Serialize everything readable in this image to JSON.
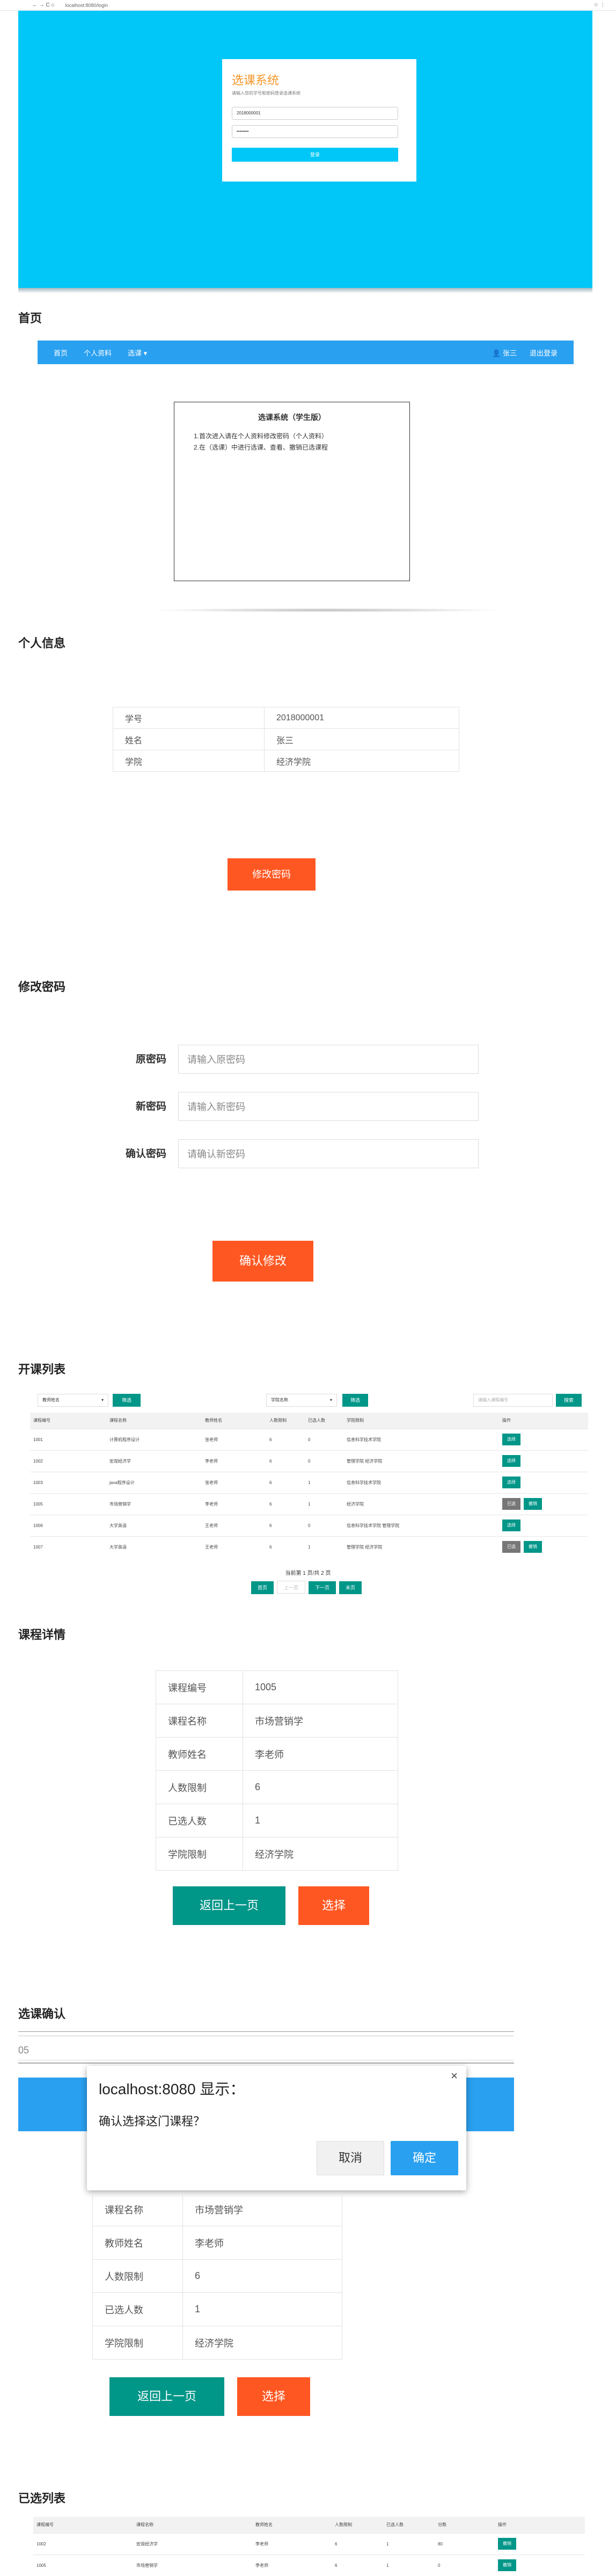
{
  "browser": {
    "url": "localhost:8080/login",
    "nav": "← → C ⌂",
    "right_icons": "☆ ⋮"
  },
  "login": {
    "title": "选课系统",
    "subtitle": "请输入您的学号和密码登录选课系统",
    "username_value": "2018000001",
    "password_value": "••••••••",
    "button": "登录"
  },
  "sections": {
    "home": "首页",
    "profile": "个人信息",
    "change_password": "修改密码",
    "course_list": "开课列表",
    "course_detail": "课程详情",
    "course_confirm": "选课确认",
    "selected_list": "已选列表"
  },
  "nav": {
    "items": [
      "首页",
      "个人资料",
      "选课 ▾"
    ],
    "user": "张三",
    "logout": "退出登录"
  },
  "home": {
    "title": "选课系统（学生版）",
    "lines": [
      "1.首次进入请在个人资料修改密码（个人资料）",
      "2.在（选课）中进行选课、查看、撤销已选课程"
    ]
  },
  "profile": {
    "rows": [
      {
        "label": "学号",
        "value": "2018000001"
      },
      {
        "label": "姓名",
        "value": "张三"
      },
      {
        "label": "学院",
        "value": "经济学院"
      }
    ],
    "button": "修改密码"
  },
  "password": {
    "old_label": "原密码",
    "old_placeholder": "请输入原密码",
    "new_label": "新密码",
    "new_placeholder": "请输入新密码",
    "confirm_label": "确认密码",
    "confirm_placeholder": "请确认新密码",
    "button": "确认修改"
  },
  "course_list": {
    "filter1": "教师姓名",
    "filter1_btn": "筛选",
    "filter2": "学院名称",
    "filter2_btn": "筛选",
    "search_placeholder": "请输入课程编号",
    "search_btn": "搜索",
    "headers": [
      "课程编号",
      "课程名称",
      "教师姓名",
      "人数限制",
      "已选人数",
      "学院限制",
      "操作"
    ],
    "rows": [
      {
        "id": "1001",
        "name": "计算机程序设计",
        "teacher": "张老师",
        "limit": "6",
        "chosen": "0",
        "college": "信息科学技术学院",
        "btns": [
          "选择"
        ]
      },
      {
        "id": "1002",
        "name": "宏观经济学",
        "teacher": "李老师",
        "limit": "6",
        "chosen": "0",
        "college": "管理学院  经济学院",
        "btns": [
          "选择"
        ]
      },
      {
        "id": "1003",
        "name": "java程序设计",
        "teacher": "张老师",
        "limit": "6",
        "chosen": "1",
        "college": "信息科学技术学院",
        "btns": [
          "选择"
        ]
      },
      {
        "id": "1005",
        "name": "市场营销学",
        "teacher": "李老师",
        "limit": "6",
        "chosen": "1",
        "college": "经济学院",
        "btns": [
          "已选",
          "撤销"
        ]
      },
      {
        "id": "1006",
        "name": "大学英语",
        "teacher": "王老师",
        "limit": "6",
        "chosen": "0",
        "college": "信息科学技术学院  管理学院",
        "btns": [
          "选择"
        ]
      },
      {
        "id": "1007",
        "name": "大学英语",
        "teacher": "王老师",
        "limit": "6",
        "chosen": "1",
        "college": "管理学院  经济学院",
        "btns": [
          "已选",
          "撤销"
        ]
      }
    ],
    "page_info": "当前第 1 页/共 2 页",
    "pager": [
      "首页",
      "上一页",
      "下一页",
      "末页"
    ]
  },
  "course_detail": {
    "rows": [
      {
        "label": "课程编号",
        "value": "1005"
      },
      {
        "label": "课程名称",
        "value": "市场营销学"
      },
      {
        "label": "教师姓名",
        "value": "李老师"
      },
      {
        "label": "人数限制",
        "value": "6"
      },
      {
        "label": "已选人数",
        "value": "1"
      },
      {
        "label": "学院限制",
        "value": "经济学院"
      }
    ],
    "back_btn": "返回上一页",
    "select_btn": "选择"
  },
  "confirm": {
    "partial_value": "05",
    "dialog_title": "localhost:8080 显示：",
    "dialog_message": "确认选择这门课程？",
    "cancel": "取消",
    "ok": "确定",
    "close": "×",
    "rows": [
      {
        "label": "课程名称",
        "value": "市场营销学"
      },
      {
        "label": "教师姓名",
        "value": "李老师"
      },
      {
        "label": "人数限制",
        "value": "6"
      },
      {
        "label": "已选人数",
        "value": "1"
      },
      {
        "label": "学院限制",
        "value": "经济学院"
      }
    ],
    "back_btn": "返回上一页",
    "select_btn": "选择"
  },
  "selected": {
    "headers": [
      "课程编号",
      "课程名称",
      "教师姓名",
      "人数限制",
      "已选人数",
      "分数",
      "操作"
    ],
    "rows": [
      {
        "id": "1002",
        "name": "宏观经济学",
        "teacher": "李老师",
        "limit": "6",
        "chosen": "1",
        "score": "80",
        "btn": "撤销"
      },
      {
        "id": "1005",
        "name": "市场营销学",
        "teacher": "李老师",
        "limit": "6",
        "chosen": "1",
        "score": "0",
        "btn": "撤销"
      }
    ]
  },
  "colors": {
    "cyan": "#00C7F7",
    "blue": "#2AA0F0",
    "orange": "#FF5722",
    "teal": "#009688",
    "login_title": "#F5962A"
  }
}
